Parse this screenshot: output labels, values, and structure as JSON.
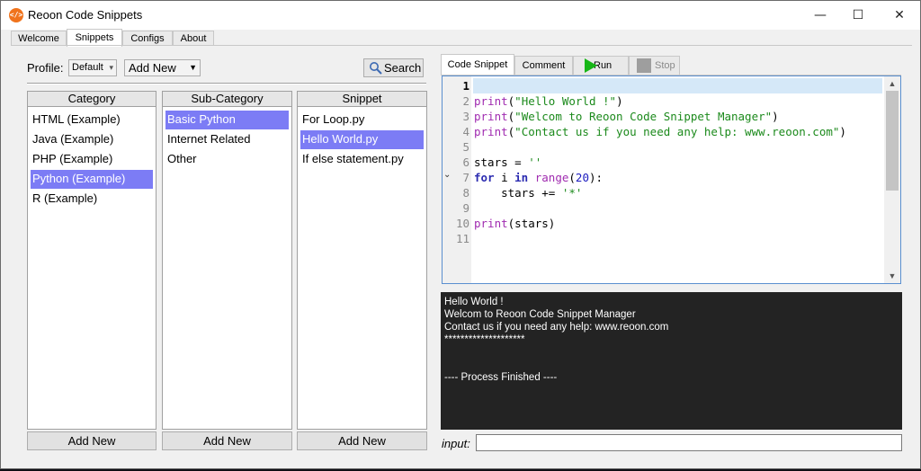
{
  "window": {
    "title": "Reoon Code Snippets",
    "icon_text": "</>",
    "minimize": "—",
    "maximize": "☐",
    "close": "✕"
  },
  "main_tabs": [
    "Welcome",
    "Snippets",
    "Configs",
    "About"
  ],
  "active_main_tab": "Snippets",
  "toolbar": {
    "profile_label": "Profile:",
    "profile_value": "Default",
    "add_new_select": "Add New",
    "search_label": "Search"
  },
  "category": {
    "header": "Category",
    "items": [
      "HTML (Example)",
      "Java (Example)",
      "PHP (Example)",
      "Python (Example)",
      "R (Example)"
    ],
    "selected": "Python (Example)",
    "add_label": "Add New"
  },
  "subcategory": {
    "header": "Sub-Category",
    "items": [
      "Basic Python",
      "Internet Related",
      "Other"
    ],
    "selected": "Basic Python",
    "add_label": "Add New"
  },
  "snippet": {
    "header": "Snippet",
    "items": [
      "For Loop.py",
      "Hello World.py",
      "If else statement.py"
    ],
    "selected": "Hello World.py",
    "add_label": "Add New"
  },
  "editor_tabs": {
    "code_snippet": "Code Snippet",
    "comment": "Comment",
    "run": "Run",
    "stop": "Stop"
  },
  "editor": {
    "line_numbers": [
      "1",
      "2",
      "3",
      "4",
      "5",
      "6",
      "7",
      "8",
      "9",
      "10",
      "11"
    ],
    "current_line": "1",
    "lines": [
      "",
      "print(\"Hello World !\")",
      "print(\"Welcom to Reoon Code Snippet Manager\")",
      "print(\"Contact us if you need any help: www.reoon.com\")",
      "",
      "stars = ''",
      "for i in range(20):",
      "    stars += '*'",
      "",
      "print(stars)",
      ""
    ]
  },
  "console": {
    "lines": [
      "Hello World !",
      "Welcom to Reoon Code Snippet Manager",
      "Contact us if you need any help: www.reoon.com",
      "********************",
      "",
      "",
      "---- Process Finished ----"
    ]
  },
  "input": {
    "label": "input:",
    "value": ""
  },
  "colors": {
    "selection": "#7c7cf5",
    "run_green": "#17b617",
    "console_bg": "#232323",
    "editor_border": "#5a8fd0"
  }
}
